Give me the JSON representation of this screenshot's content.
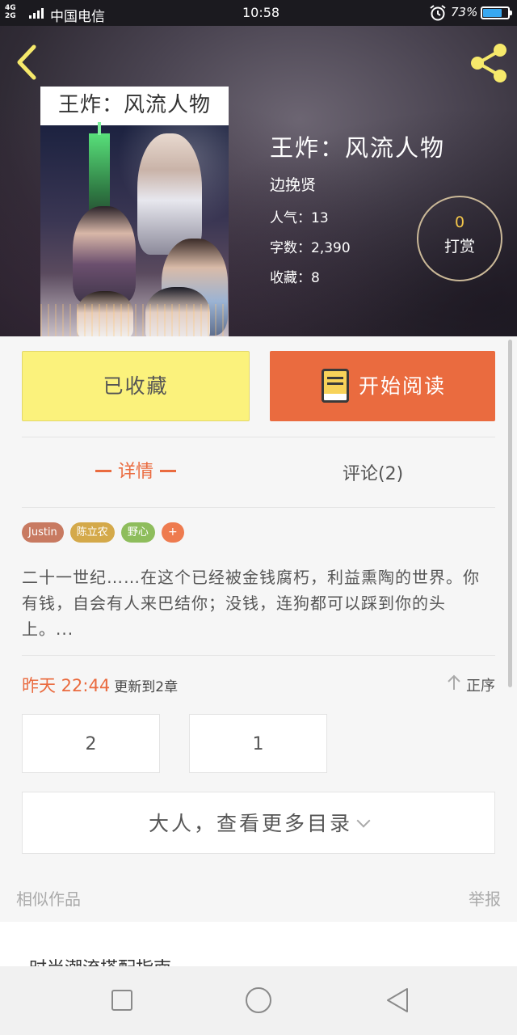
{
  "status_bar": {
    "network": "4G\n2G",
    "carrier": "中国电信",
    "time": "10:58",
    "battery": "73%",
    "battery_level": 0.73,
    "battery_color": "#38a8f0"
  },
  "header": {
    "back_icon": "chevron-left",
    "share_icon": "share",
    "icon_color": "#f6e96b"
  },
  "book": {
    "cover_title": "王炸：风流人物",
    "title": "王炸：风流人物",
    "author": "边挽贤",
    "popularity": "人气：13",
    "word_count": "字数：2,390",
    "favorites": "收藏：8"
  },
  "tip": {
    "count": "0",
    "label": "打赏"
  },
  "actions": {
    "collected": "已收藏",
    "start_reading": "开始阅读",
    "collected_color": "#fbf27c",
    "read_color": "#ea6b3f"
  },
  "tabs": {
    "detail": "详情",
    "comments": "评论(2)"
  },
  "tags": [
    {
      "label": "Justin",
      "color": "#c87a61"
    },
    {
      "label": "陈立农",
      "color": "#d4a94a"
    },
    {
      "label": "野心",
      "color": "#8ebd5c"
    }
  ],
  "tag_add": "+",
  "summary": "二十一世纪……在这个已经被金钱腐朽，利益熏陶的世界。你有钱，自会有人来巴结你；没钱，连狗都可以踩到你的头上。...",
  "update": {
    "time": "昨天 22:44",
    "text": "更新到2章",
    "sort": "正序"
  },
  "chapters": [
    "2",
    "1"
  ],
  "more_catalog": "大人，查看更多目录",
  "similar": {
    "label": "相似作品",
    "report": "举报",
    "first_title": "时尚潮流搭配指南"
  },
  "nav": {
    "recent": "square",
    "home": "circle",
    "back": "triangle"
  }
}
